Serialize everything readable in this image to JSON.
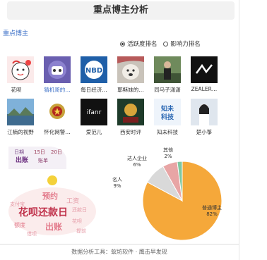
{
  "title": "重点博主分析",
  "section_link": "重点博主",
  "radios": [
    {
      "label": "活跃度排名",
      "selected": true
    },
    {
      "label": "影响力排名",
      "selected": false
    }
  ],
  "bloggers": [
    {
      "name": "花呗",
      "icon": "cartoon-avatar",
      "highlight": false
    },
    {
      "name": "猜机哥的…",
      "icon": "robot-avatar",
      "highlight": true
    },
    {
      "name": "每日经济…",
      "icon": "nbd-logo",
      "highlight": false
    },
    {
      "name": "耶稣妹的…",
      "icon": "dog-avatar",
      "highlight": false
    },
    {
      "name": "同马子潇潇",
      "icon": "person-photo",
      "highlight": false
    },
    {
      "name": "ZEALER…",
      "icon": "zealer-logo",
      "highlight": false
    },
    {
      "name": "江楠的视野",
      "icon": "landscape-avatar",
      "highlight": false
    },
    {
      "name": "怀化网警…",
      "icon": "police-badge",
      "highlight": false
    },
    {
      "name": "爱范儿",
      "icon": "ifanr-logo",
      "highlight": false
    },
    {
      "name": "西安时评",
      "icon": "dark-photo",
      "highlight": false
    },
    {
      "name": "知未科技",
      "icon": "zhiwei-logo",
      "highlight": false
    },
    {
      "name": "楚小筝",
      "icon": "girl-photo",
      "highlight": false
    }
  ],
  "logo_text": {
    "nbd": "NBD",
    "ifanr": "ifanr",
    "zhiwei": [
      "知未",
      "科技"
    ]
  },
  "wordcloud": {
    "words": [
      "花呗还款日",
      "预约",
      "工资",
      "出账",
      "额度",
      "账单",
      "还款日",
      "日期",
      "15日",
      "20日",
      "支付宝",
      "借呗",
      "花呗",
      "提前",
      "出账"
    ]
  },
  "chart_data": {
    "type": "pie",
    "categories": [
      "普通博主",
      "名人",
      "达人企业",
      "其他"
    ],
    "values": [
      82,
      9,
      6,
      2
    ],
    "labels": [
      "普通博主\n82%",
      "名人\n9%",
      "达人企业\n6%",
      "其他\n2%"
    ],
    "colors": [
      "#f5a83a",
      "#d9d9d9",
      "#e8a5a5",
      "#7fc7a0",
      "#6bb6d6"
    ]
  },
  "footer": "数据分析工具：蚁坊软件 · 鹰击早发现"
}
